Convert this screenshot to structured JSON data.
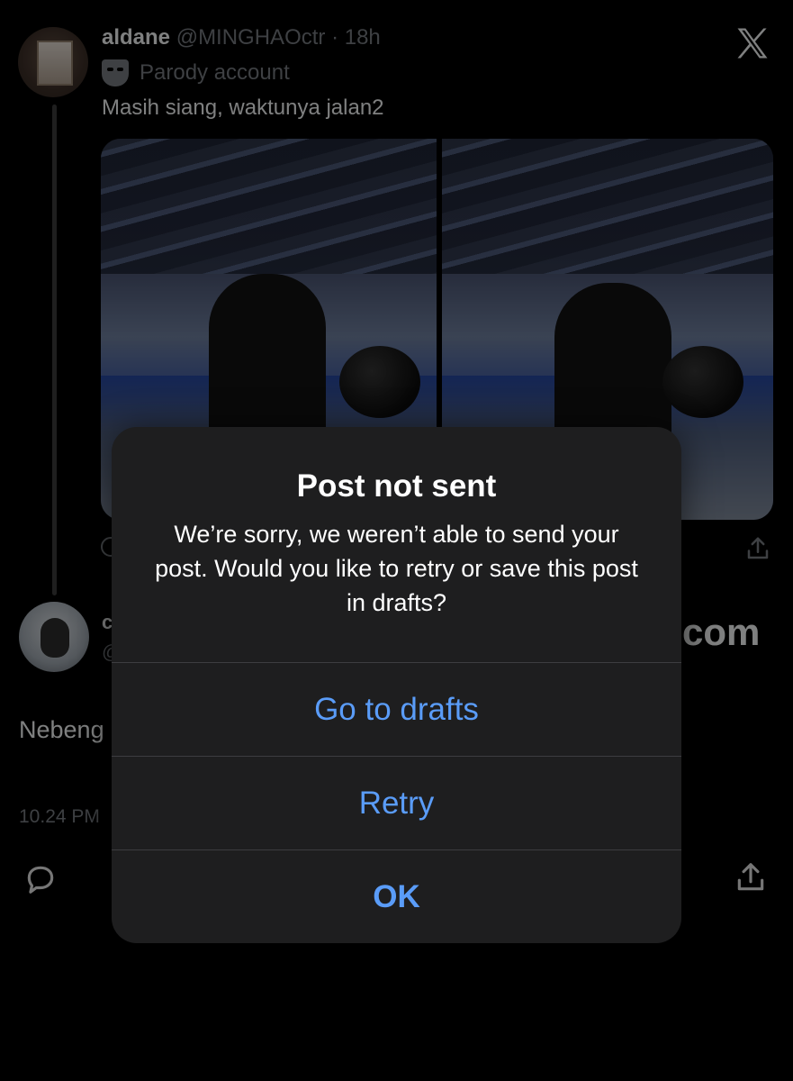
{
  "tweet": {
    "name": "aldane",
    "handle": "@MINGHAOctr · 18h",
    "parody_label": "Parody account",
    "text": "Masih siang, waktunya jalan2",
    "media_count": 2
  },
  "second_post": {
    "name_partial": "c",
    "handle_partial": "@",
    "link_fragment": "com",
    "text_partial": "Nebeng",
    "time_partial": "10.24 PM"
  },
  "icons": {
    "brand": "x-logo-icon",
    "parody": "theater-mask-icon",
    "reply": "reply-bubble-icon",
    "share": "share-upload-icon"
  },
  "alert": {
    "title": "Post not sent",
    "message": "We’re sorry, we weren’t able to send your post. Would you like to retry or save this post in drafts?",
    "buttons": {
      "drafts": "Go to drafts",
      "retry": "Retry",
      "ok": "OK"
    }
  },
  "colors": {
    "background": "#000000",
    "dialog_background": "#1e1e1f",
    "button_text": "#5a9cf8",
    "secondary_text": "#71767b"
  }
}
